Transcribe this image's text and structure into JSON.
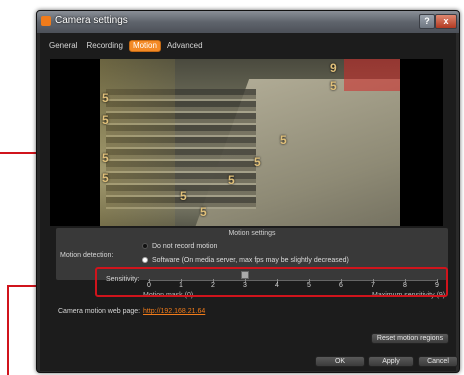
{
  "window": {
    "title": "Camera settings",
    "help_label": "?",
    "close_label": "x"
  },
  "tabs": [
    {
      "label": "General",
      "active": false
    },
    {
      "label": "Recording",
      "active": false
    },
    {
      "label": "Motion",
      "active": true
    },
    {
      "label": "Advanced",
      "active": false
    }
  ],
  "video": {
    "grid_numbers": [
      "5",
      "5",
      "9",
      "5",
      "5",
      "5",
      "5",
      "5",
      "5",
      "5",
      "5"
    ]
  },
  "motion_settings": {
    "title": "Motion settings",
    "detection_label": "Motion detection:",
    "options": [
      {
        "label": "Do not record motion",
        "selected": false
      },
      {
        "label": "Software (On media server, max fps may be slightly decreased)",
        "selected": true
      }
    ]
  },
  "sensitivity": {
    "label": "Sensitivity:",
    "ticks": [
      "0",
      "1",
      "2",
      "3",
      "4",
      "5",
      "6",
      "7",
      "8",
      "9"
    ],
    "value": 3,
    "min_label": "Motion mask (0)",
    "max_label": "Maximum sensitivity (9)"
  },
  "web_page": {
    "label": "Camera motion web page:",
    "link": "http://192.168.21.64"
  },
  "buttons": {
    "reset": "Reset motion regions",
    "ok": "OK",
    "apply": "Apply",
    "cancel": "Cancel"
  },
  "colors": {
    "accent": "#f48a26",
    "callout": "#d0141c",
    "motion_region": "#d22828"
  }
}
